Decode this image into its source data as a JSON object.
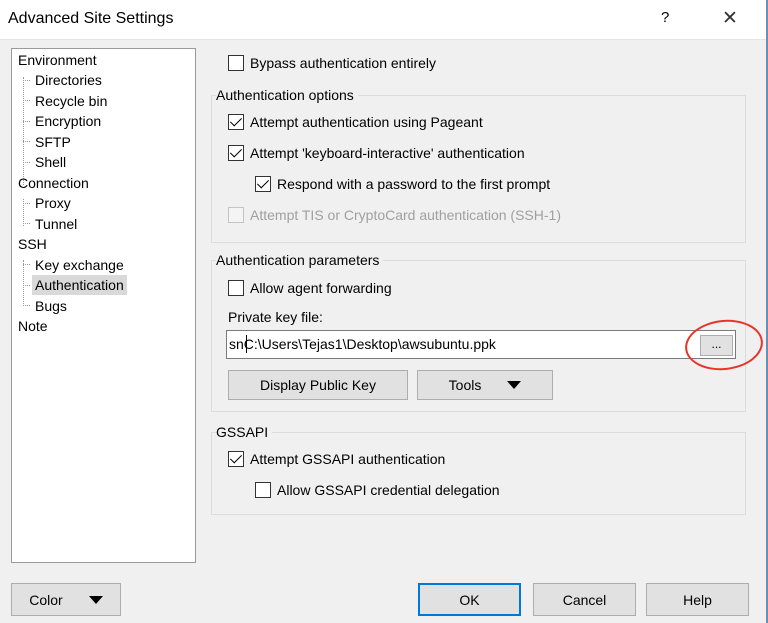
{
  "window": {
    "title": "Advanced Site Settings",
    "help": "?",
    "close": "✕"
  },
  "tree": {
    "items": [
      {
        "label": "Environment"
      },
      {
        "label": "Directories"
      },
      {
        "label": "Recycle bin"
      },
      {
        "label": "Encryption"
      },
      {
        "label": "SFTP"
      },
      {
        "label": "Shell"
      },
      {
        "label": "Connection"
      },
      {
        "label": "Proxy"
      },
      {
        "label": "Tunnel"
      },
      {
        "label": "SSH"
      },
      {
        "label": "Key exchange"
      },
      {
        "label": "Authentication",
        "selected": true
      },
      {
        "label": "Bugs"
      },
      {
        "label": "Note"
      }
    ]
  },
  "bypass": {
    "label": "Bypass authentication entirely",
    "checked": false
  },
  "auth_options": {
    "title": "Authentication options",
    "pageant": {
      "label": "Attempt authentication using Pageant",
      "checked": true
    },
    "keyboard": {
      "label": "Attempt 'keyboard-interactive' authentication",
      "checked": true
    },
    "respond": {
      "label": "Respond with a password to the first prompt",
      "checked": true
    },
    "tis": {
      "label": "Attempt TIS or CryptoCard authentication (SSH-1)",
      "checked": false,
      "disabled": true
    }
  },
  "auth_params": {
    "title": "Authentication parameters",
    "agent_forwarding": {
      "label": "Allow agent forwarding",
      "checked": false
    },
    "private_key_label": "Private key file:",
    "private_key_value": "snC:\\Users\\Tejas1\\Desktop\\awsubuntu.ppk",
    "browse_label": "...",
    "display_key_label": "Display Public Key",
    "tools_label": "Tools"
  },
  "gssapi": {
    "title": "GSSAPI",
    "attempt": {
      "label": "Attempt GSSAPI authentication",
      "checked": true
    },
    "delegation": {
      "label": "Allow GSSAPI credential delegation",
      "checked": false
    }
  },
  "footer": {
    "color_label": "Color",
    "ok_label": "OK",
    "cancel_label": "Cancel",
    "help_label": "Help"
  },
  "colors": {
    "accent": "#0078d7",
    "annotation": "#e8342b",
    "selection": "#d9d9d9"
  }
}
